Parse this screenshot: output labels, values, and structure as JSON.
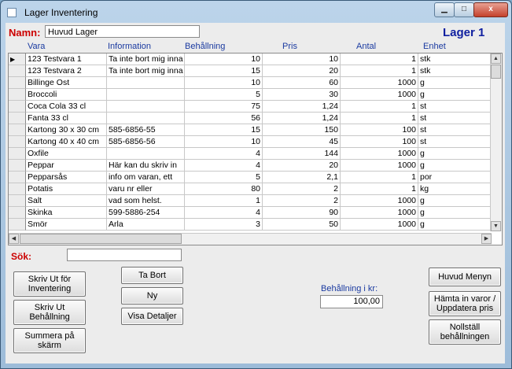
{
  "window": {
    "title": "Lager Inventering",
    "close_glyph": "x"
  },
  "form": {
    "name_label": "Namn:",
    "name_value": "Huvud Lager",
    "heading": "Lager 1",
    "search_label": "Sök:",
    "search_value": "",
    "balance_label": "Behållning i kr:",
    "balance_value": "100,00"
  },
  "grid": {
    "columns": [
      "Vara",
      "Information",
      "Behållning",
      "Pris",
      "Antal",
      "Enhet"
    ],
    "current_row_marker": "▶",
    "rows": [
      [
        "123 Testvara 1",
        "Ta inte bort mig inna",
        "10",
        "10",
        "1",
        "stk"
      ],
      [
        "123 Testvara 2",
        "Ta inte bort mig inna",
        "15",
        "20",
        "1",
        "stk"
      ],
      [
        "Billinge Ost",
        "",
        "10",
        "60",
        "1000",
        "g"
      ],
      [
        "Broccoli",
        "",
        "5",
        "30",
        "1000",
        "g"
      ],
      [
        "Coca Cola 33 cl",
        "",
        "75",
        "1,24",
        "1",
        "st"
      ],
      [
        "Fanta 33 cl",
        "",
        "56",
        "1,24",
        "1",
        "st"
      ],
      [
        "Kartong 30 x 30 cm",
        "585-6856-55",
        "15",
        "150",
        "100",
        "st"
      ],
      [
        "Kartong 40 x 40 cm",
        "585-6856-56",
        "10",
        "45",
        "100",
        "st"
      ],
      [
        "Oxfile",
        "",
        "4",
        "144",
        "1000",
        "g"
      ],
      [
        "Peppar",
        "Här kan du skriv in",
        "4",
        "20",
        "1000",
        "g"
      ],
      [
        "Pepparsås",
        "info om varan, ett",
        "5",
        "2,1",
        "1",
        "por"
      ],
      [
        "Potatis",
        "varu nr eller",
        "80",
        "2",
        "1",
        "kg"
      ],
      [
        "Salt",
        "vad som helst.",
        "1",
        "2",
        "1000",
        "g"
      ],
      [
        "Skinka",
        "599-5886-254",
        "4",
        "90",
        "1000",
        "g"
      ],
      [
        "Smör",
        "Arla",
        "3",
        "50",
        "1000",
        "g"
      ]
    ]
  },
  "buttons": {
    "print_inventory": "Skriv Ut för Inventering",
    "print_balance": "Skriv Ut Behållning",
    "sum_screen": "Summera på skärm",
    "delete": "Ta Bort",
    "new": "Ny",
    "show_details": "Visa Detaljer",
    "main_menu": "Huvud Menyn",
    "fetch_update": "Hämta in varor / Uppdatera pris",
    "reset_balance": "Nollställ behållningen"
  }
}
